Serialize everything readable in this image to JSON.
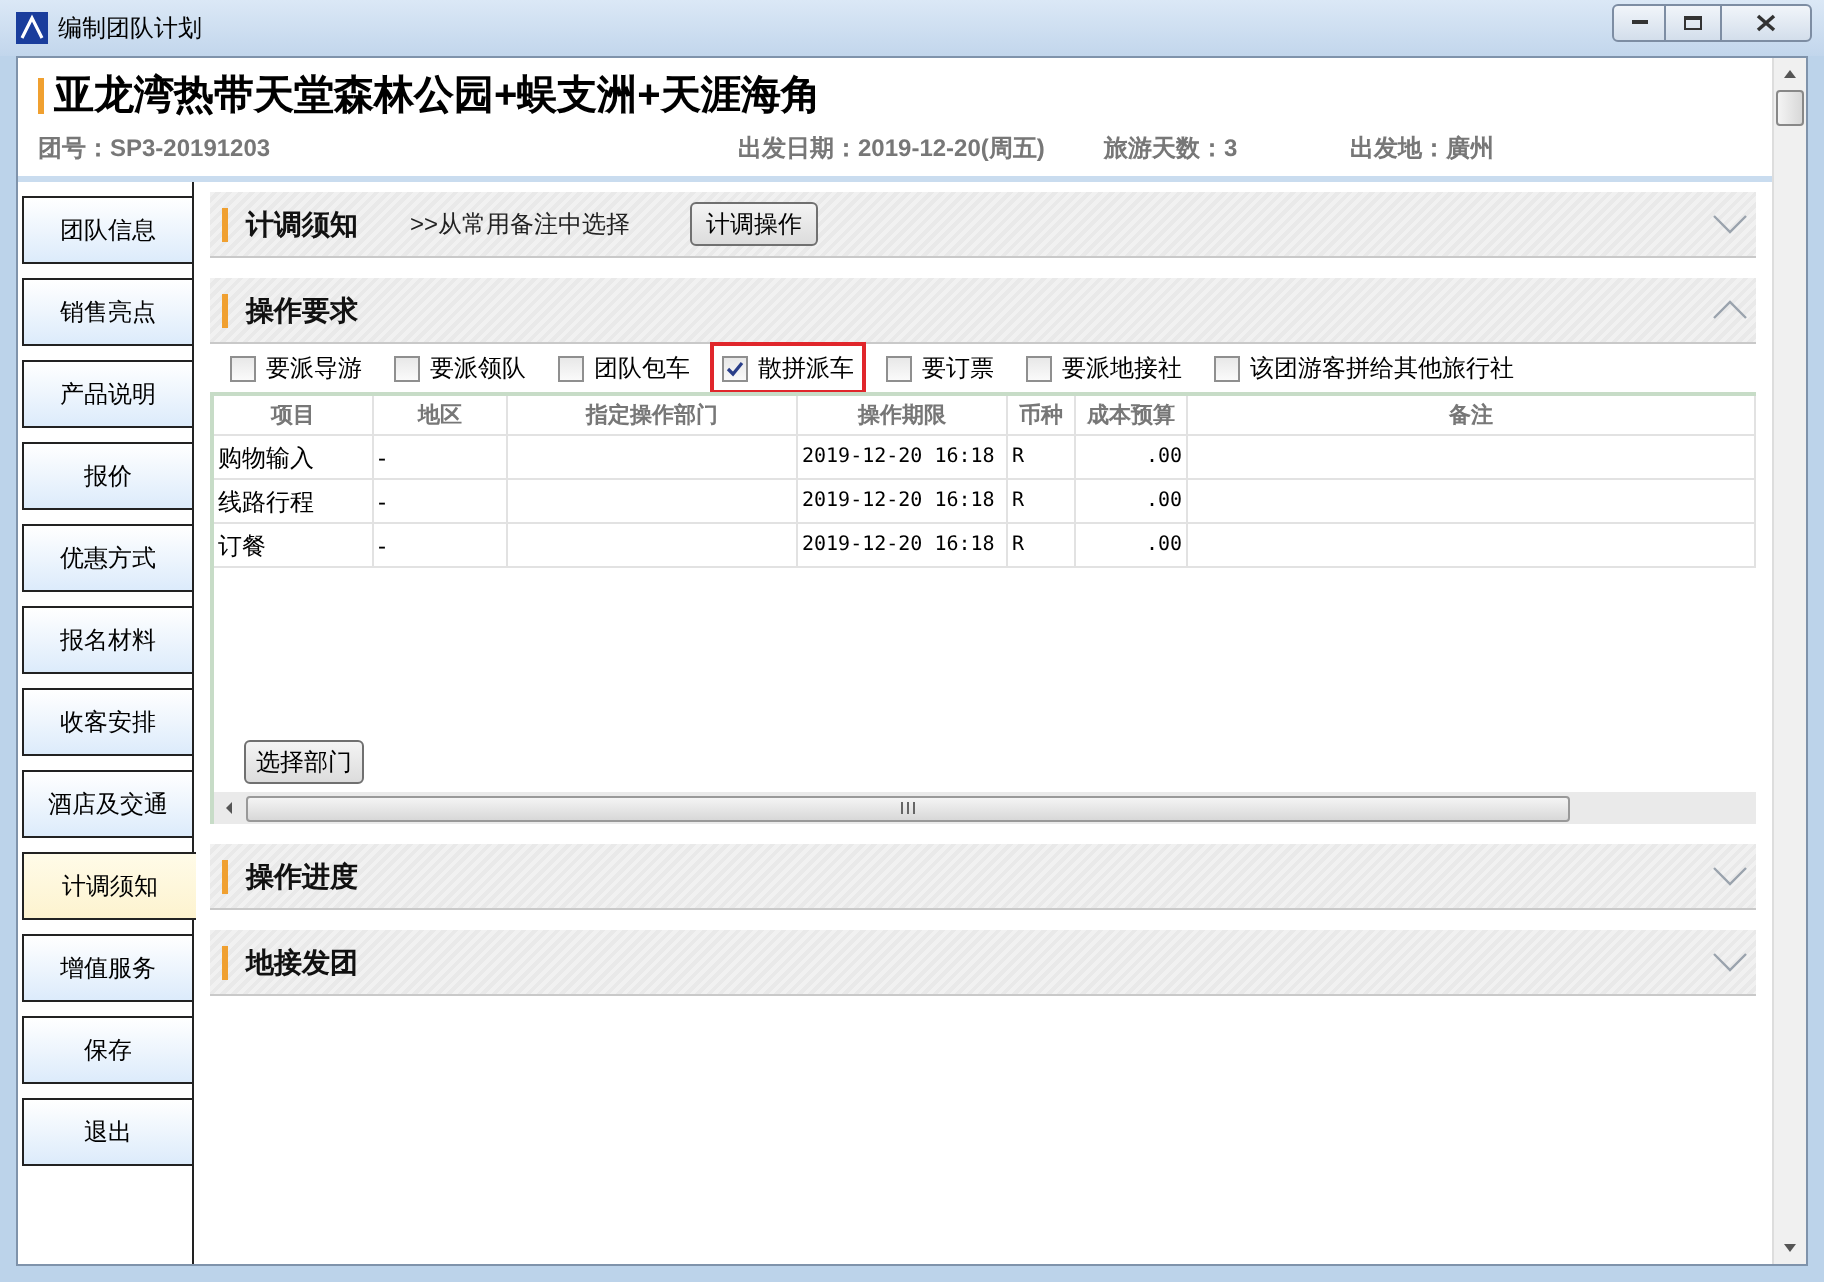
{
  "window": {
    "title": "编制团队计划"
  },
  "header": {
    "title": "亚龙湾热带天堂森林公园+蜈支洲+天涯海角",
    "group_no": "团号：SP3-20191203",
    "depart_date": "出发日期：2019-12-20(周五)",
    "days": "旅游天数：3",
    "depart_place": "出发地：廣州"
  },
  "sidebar": {
    "items": [
      {
        "label": "团队信息",
        "selected": false
      },
      {
        "label": "销售亮点",
        "selected": false
      },
      {
        "label": "产品说明",
        "selected": false
      },
      {
        "label": "报价",
        "selected": false
      },
      {
        "label": "优惠方式",
        "selected": false
      },
      {
        "label": "报名材料",
        "selected": false
      },
      {
        "label": "收客安排",
        "selected": false
      },
      {
        "label": "酒店及交通",
        "selected": false
      },
      {
        "label": "计调须知",
        "selected": true
      },
      {
        "label": "增值服务",
        "selected": false
      },
      {
        "label": "保存",
        "selected": false
      },
      {
        "label": "退出",
        "selected": false
      }
    ]
  },
  "sections": [
    {
      "title": "计调须知",
      "expanded": false,
      "link": ">>从常用备注中选择",
      "button": "计调操作"
    },
    {
      "title": "操作要求",
      "expanded": true,
      "checkboxes": [
        {
          "label": "要派导游",
          "checked": false,
          "highlighted": false
        },
        {
          "label": "要派领队",
          "checked": false,
          "highlighted": false
        },
        {
          "label": "团队包车",
          "checked": false,
          "highlighted": false
        },
        {
          "label": "散拼派车",
          "checked": true,
          "highlighted": true
        },
        {
          "label": "要订票",
          "checked": false,
          "highlighted": false
        },
        {
          "label": "要派地接社",
          "checked": false,
          "highlighted": false
        },
        {
          "label": "该团游客拼给其他旅行社",
          "checked": false,
          "highlighted": false
        }
      ],
      "table": {
        "columns": [
          "项目",
          "地区",
          "指定操作部门",
          "操作期限",
          "币种",
          "成本预算",
          "备注"
        ],
        "rows": [
          [
            "购物输入",
            "-",
            "",
            "2019-12-20 16:18",
            "R",
            ".00",
            ""
          ],
          [
            "线路行程",
            "-",
            "",
            "2019-12-20 16:18",
            "R",
            ".00",
            ""
          ],
          [
            "订餐",
            "-",
            "",
            "2019-12-20 16:18",
            "R",
            ".00",
            ""
          ]
        ]
      },
      "button": "选择部门"
    },
    {
      "title": "操作进度",
      "expanded": false
    },
    {
      "title": "地接发团",
      "expanded": false
    }
  ]
}
